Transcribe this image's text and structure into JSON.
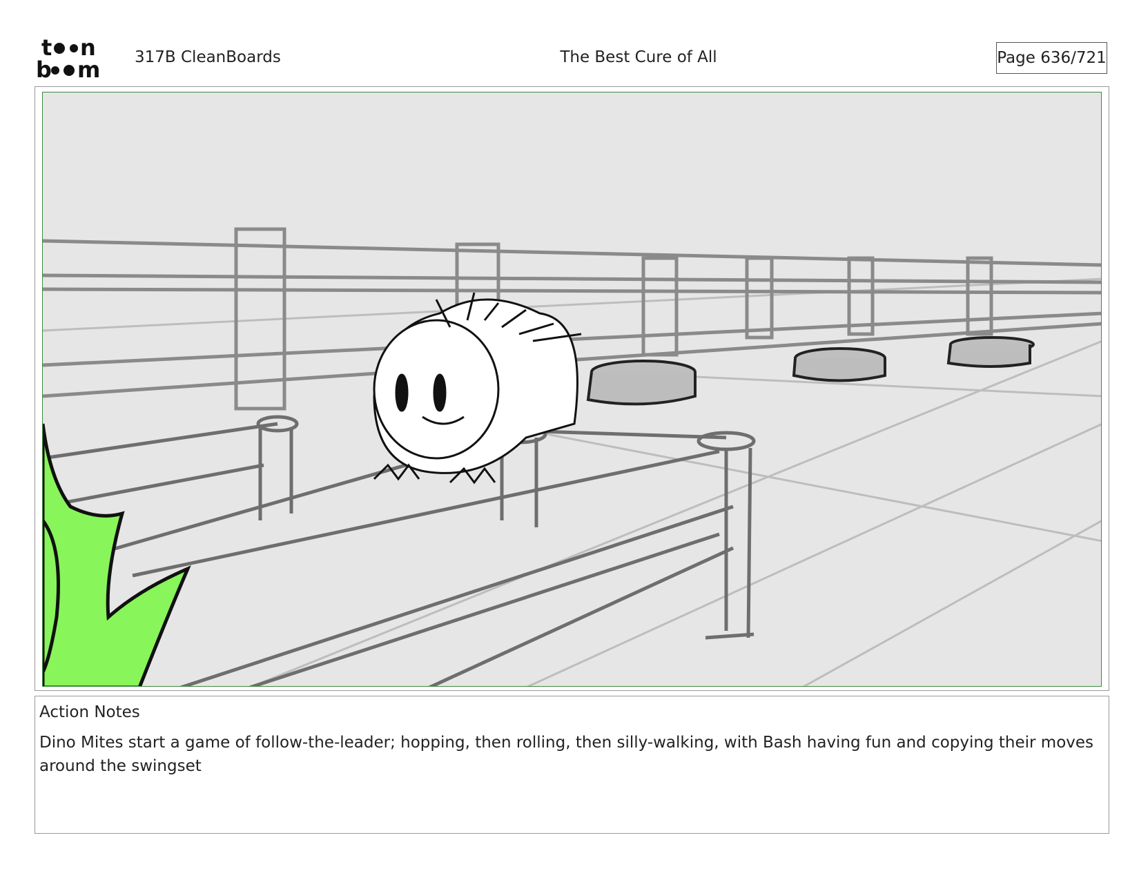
{
  "header": {
    "logo_text": "toonboom",
    "project": "317B  CleanBoards",
    "title": "The Best Cure of All",
    "page": "Page 636/721"
  },
  "panel": {
    "colors": {
      "background": "#e6e6e6",
      "frame": "#3c8a3c",
      "foliage": "#88f55a",
      "line": "#111111",
      "structure": "#6e6e6e"
    }
  },
  "notes": {
    "heading": "Action Notes",
    "body": "Dino Mites start a game of follow-the-leader; hopping, then rolling, then silly-walking, with Bash having fun and copying their moves around the swingset"
  }
}
